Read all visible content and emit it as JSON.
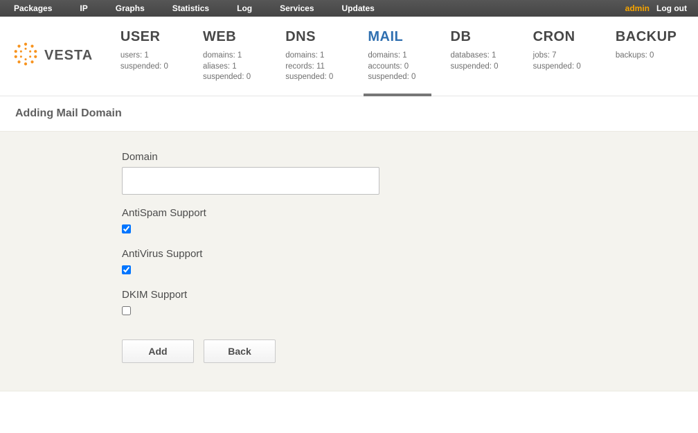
{
  "topnav": {
    "items": [
      "Packages",
      "IP",
      "Graphs",
      "Statistics",
      "Log",
      "Services",
      "Updates"
    ],
    "user": "admin",
    "logout": "Log out"
  },
  "logo": {
    "text": "VESTA"
  },
  "tabs": [
    {
      "title": "USER",
      "lines": [
        "users: 1",
        "suspended: 0"
      ]
    },
    {
      "title": "WEB",
      "lines": [
        "domains: 1",
        "aliases: 1",
        "suspended: 0"
      ]
    },
    {
      "title": "DNS",
      "lines": [
        "domains: 1",
        "records: 11",
        "suspended: 0"
      ]
    },
    {
      "title": "MAIL",
      "lines": [
        "domains: 1",
        "accounts: 0",
        "suspended: 0"
      ],
      "active": true
    },
    {
      "title": "DB",
      "lines": [
        "databases: 1",
        "suspended: 0"
      ]
    },
    {
      "title": "CRON",
      "lines": [
        "jobs: 7",
        "suspended: 0"
      ]
    },
    {
      "title": "BACKUP",
      "lines": [
        "backups: 0"
      ]
    }
  ],
  "page": {
    "title": "Adding Mail Domain"
  },
  "form": {
    "domain_label": "Domain",
    "domain_value": "",
    "antispam_label": "AntiSpam Support",
    "antispam_checked": true,
    "antivirus_label": "AntiVirus Support",
    "antivirus_checked": true,
    "dkim_label": "DKIM Support",
    "dkim_checked": false,
    "add_button": "Add",
    "back_button": "Back"
  }
}
